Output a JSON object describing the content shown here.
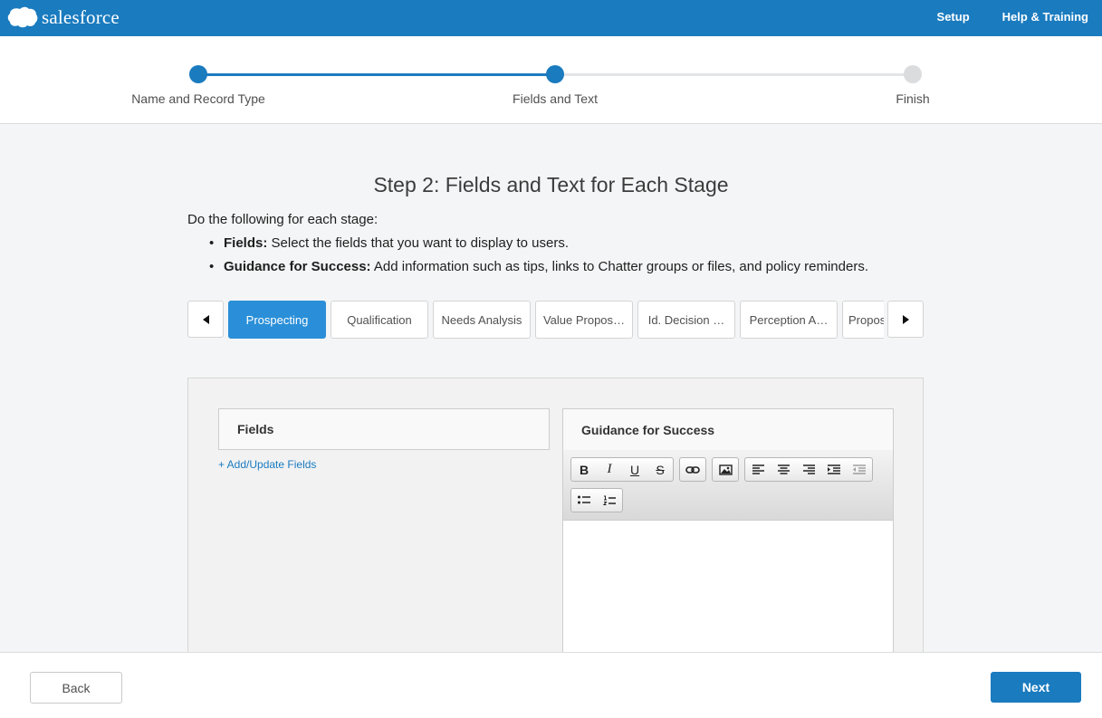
{
  "header": {
    "logo_text": "salesforce",
    "links": [
      "Setup",
      "Help & Training"
    ]
  },
  "progress": {
    "steps": [
      {
        "label": "Name and Record Type",
        "state": "complete"
      },
      {
        "label": "Fields and Text",
        "state": "current"
      },
      {
        "label": "Finish",
        "state": "upcoming"
      }
    ]
  },
  "main": {
    "title": "Step 2: Fields and Text for Each Stage",
    "intro": "Do the following for each stage:",
    "bullets": [
      {
        "term": "Fields:",
        "text": " Select the fields that you want to display to users."
      },
      {
        "term": "Guidance for Success:",
        "text": " Add information such as tips, links to Chatter groups or files, and policy reminders."
      }
    ]
  },
  "stages": {
    "tabs": [
      "Prospecting",
      "Qualification",
      "Needs Analysis",
      "Value Propos…",
      "Id. Decision …",
      "Perception A…",
      "Propos"
    ],
    "selected": "Prospecting"
  },
  "fields_panel": {
    "title": "Fields",
    "add_link": "+ Add/Update Fields"
  },
  "guidance_panel": {
    "title": "Guidance for Success",
    "toolbar": {
      "format": [
        {
          "name": "bold",
          "glyph": "B"
        },
        {
          "name": "italic",
          "glyph": "I"
        },
        {
          "name": "underline",
          "glyph": "U"
        },
        {
          "name": "strikethrough",
          "glyph": "S"
        }
      ],
      "link_icon": "link-icon",
      "image_icon": "image-icon",
      "align_icons": [
        "align-left-icon",
        "align-center-icon",
        "align-right-icon",
        "indent-icon",
        "outdent-icon"
      ],
      "list_icons": [
        "bulleted-list-icon",
        "numbered-list-icon"
      ]
    }
  },
  "footer": {
    "back_label": "Back",
    "next_label": "Next"
  },
  "colors": {
    "brand": "#1a7bbf",
    "active_tab": "#2a8fd8"
  }
}
